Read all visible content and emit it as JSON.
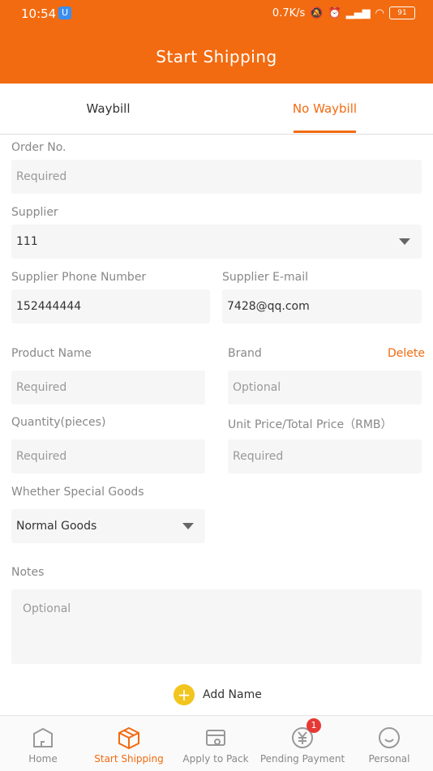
{
  "status": {
    "time": "10:54",
    "speed": "0.7K/s",
    "battery": "91"
  },
  "header": {
    "title": "Start Shipping"
  },
  "tabs": [
    {
      "label": "Waybill"
    },
    {
      "label": "No Waybill"
    }
  ],
  "form": {
    "order_label": "Order No.",
    "order_placeholder": "Required",
    "supplier_label": "Supplier",
    "supplier_value": "111",
    "phone_label": "Supplier Phone Number",
    "phone_value": "152444444",
    "email_label": "Supplier E-mail",
    "email_value": "7428@qq.com",
    "product_label": "Product Name",
    "product_placeholder": "Required",
    "brand_label": "Brand",
    "brand_placeholder": "Optional",
    "delete_label": "Delete",
    "qty_label": "Quantity(pieces)",
    "qty_placeholder": "Required",
    "price_label": "Unit Price/Total Price（RMB）",
    "price_placeholder": "Required",
    "special_label": "Whether Special Goods",
    "special_value": "Normal Goods",
    "notes_label": "Notes",
    "notes_placeholder": "Optional",
    "add_label": "Add Name"
  },
  "nav": [
    {
      "label": "Home"
    },
    {
      "label": "Start Shipping"
    },
    {
      "label": "Apply to Pack"
    },
    {
      "label": "Pending Payment",
      "badge": "1"
    },
    {
      "label": "Personal"
    }
  ],
  "colors": {
    "accent": "#F26B10",
    "add": "#F2C41E",
    "badge": "#e53935"
  }
}
